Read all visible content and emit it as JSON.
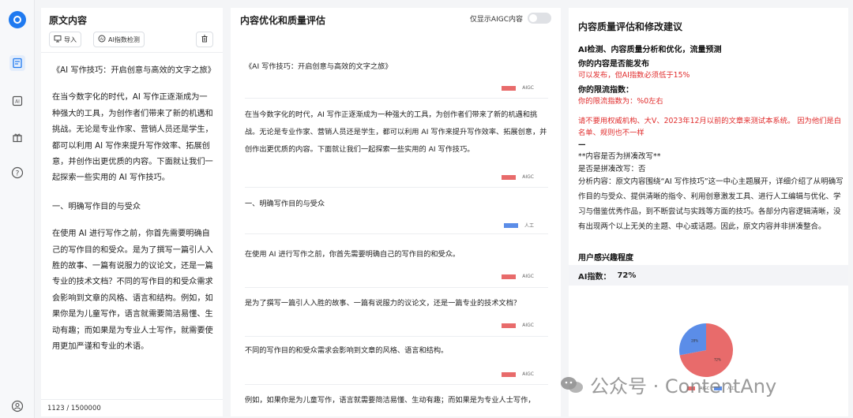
{
  "sidebar": {
    "icons": [
      "app-logo",
      "document-icon",
      "ai-icon",
      "gift-icon",
      "help-icon",
      "user-icon"
    ],
    "accent": "#1f7af0"
  },
  "original": {
    "title": "原文内容",
    "toolbar": {
      "import_label": "导入",
      "detect_label": "AI指数检测"
    },
    "paragraphs": [
      "《AI 写作技巧：开启创意与高效的文字之旅》",
      "在当今数字化的时代，AI 写作正逐渐成为一种强大的工具，为创作者们带来了新的机遇和挑战。无论是专业作家、营销人员还是学生，都可以利用 AI 写作来提升写作效率、拓展创意，并创作出更优质的内容。下面就让我们一起探索一些实用的 AI 写作技巧。",
      "一、明确写作目的与受众",
      "在使用 AI 进行写作之前，你首先需要明确自己的写作目的和受众。是为了撰写一篇引人入胜的故事、一篇有说服力的议论文，还是一篇专业的技术文档？不同的写作目的和受众需求会影响到文章的风格、语言和结构。例如，如果你是为儿童写作，语言就需要简洁易懂、生动有趣；而如果是为专业人士写作，就需要使用更加严谨和专业的术语。"
    ],
    "counter": "1123 / 1500000"
  },
  "optimize": {
    "title": "内容优化和质量评估",
    "toggle_label": "仅显示AIGC内容",
    "toggle_on": false,
    "segments": [
      {
        "text": "《AI 写作技巧：开启创意与高效的文字之旅》",
        "tag": "AIGC",
        "color": "#e86b6b"
      },
      {
        "text": "在当今数字化的时代，AI 写作正逐渐成为一种强大的工具，为创作者们带来了新的机遇和挑战。无论是专业作家、营销人员还是学生，都可以利用 AI 写作来提升写作效率、拓展创意，并创作出更优质的内容。下面就让我们一起探索一些实用的 AI 写作技巧。",
        "tag": "AIGC",
        "color": "#e86b6b"
      },
      {
        "text": "一、明确写作目的与受众",
        "tag": "人工",
        "color": "#5b8de8"
      },
      {
        "text": "在使用 AI 进行写作之前，你首先需要明确自己的写作目的和受众。",
        "tag": "AIGC",
        "color": "#e86b6b"
      },
      {
        "text": "是为了撰写一篇引人入胜的故事、一篇有说服力的议论文，还是一篇专业的技术文档？",
        "tag": "AIGC",
        "color": "#e86b6b"
      },
      {
        "text": "不同的写作目的和受众需求会影响到文章的风格、语言和结构。",
        "tag": "AIGC",
        "color": "#e86b6b"
      },
      {
        "text": "例如，如果你是为儿童写作，语言就需要简洁易懂、生动有趣；而如果是为专业人士写作，",
        "tag": "",
        "color": ""
      }
    ]
  },
  "assessment": {
    "title": "内容质量评估和修改建议",
    "subtitle": "AI检测、内容质量分析和优化，流量预测",
    "publish_head": "你的内容是否能发布",
    "publish_value": "可以发布，但AI指数必须低于15%",
    "limit_head": "你的限流指数：",
    "limit_value": "你的限流指数为：%0左右",
    "warning": "请不要用权威机构、大V、2023年12月以前的文章来测试本系统。 因为他们是白名单、规则也不一样",
    "dash": "—",
    "concat_head": "**内容是否为拼凑改写**",
    "concat_answer": "是否是拼凑改写：否",
    "analysis": "分析内容：原文内容围绕“AI 写作技巧”这一中心主题展开，详细介绍了从明确写作目的与受众、提供清晰的指令、利用创意激发工具、进行人工编辑与优化、学习与借鉴优秀作品，到不断尝试与实践等方面的技巧。各部分内容逻辑清晰，没有出现两个以上无关的主题、中心或话题。因此，原文内容并非拼凑整合。",
    "interest_head": "用户感兴趣程度",
    "ai_index_label": "AI指数：",
    "ai_index_value": "72%"
  },
  "chart_data": {
    "type": "pie",
    "labels": [
      "AIGC",
      "人工"
    ],
    "values": [
      72,
      28
    ],
    "colors": [
      "#e86b6b",
      "#5b8de8"
    ],
    "slice_labels": [
      "72%",
      "28%"
    ]
  },
  "watermark": {
    "text": "公众号 · ContentAny"
  }
}
